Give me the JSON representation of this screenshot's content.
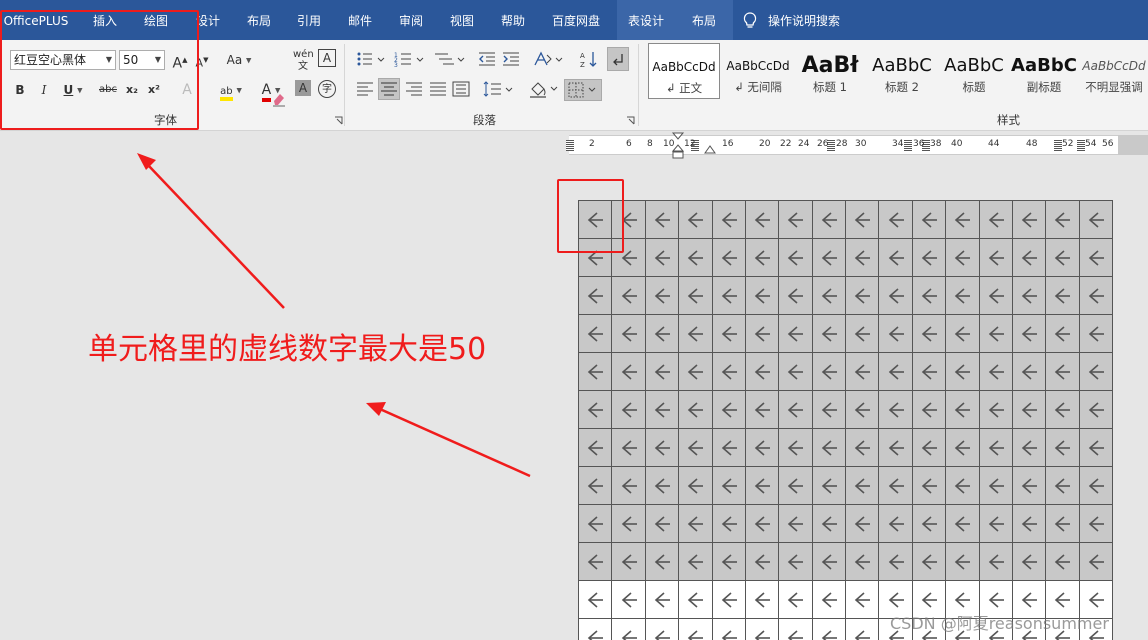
{
  "menu": {
    "items": [
      "OfficePLUS",
      "插入",
      "绘图",
      "设计",
      "布局",
      "引用",
      "邮件",
      "审阅",
      "视图",
      "帮助",
      "百度网盘"
    ],
    "context_tabs": [
      "表设计",
      "布局"
    ],
    "tell_me": "操作说明搜索"
  },
  "font_group": {
    "font_name": "红豆空心黑体",
    "font_size": "50",
    "grow_font": "A",
    "shrink_font": "A",
    "change_case": "Aa",
    "pinyin": "wén",
    "char_border": "A",
    "bold": "B",
    "italic": "I",
    "underline": "U",
    "strikethrough": "abc",
    "subscript": "x₂",
    "superscript": "x²",
    "text_effects": "A",
    "highlight": "ab",
    "font_color": "A",
    "char_shading": "A",
    "enclose_char": "字",
    "label": "字体"
  },
  "paragraph_group": {
    "label": "段落"
  },
  "styles_group": {
    "label": "样式",
    "styles": [
      {
        "sample": "AaBbCcDd",
        "name": "↲ 正文"
      },
      {
        "sample": "AaBbCcDd",
        "name": "↲ 无间隔"
      },
      {
        "sample": "AaBł",
        "name": "标题 1"
      },
      {
        "sample": "AaBbC",
        "name": "标题 2"
      },
      {
        "sample": "AaBbC",
        "name": "标题"
      },
      {
        "sample": "AaBbC",
        "name": "副标题"
      },
      {
        "sample": "AaBbCcDd",
        "name": "不明显强调"
      }
    ]
  },
  "ruler": {
    "numbers": [
      "2",
      "6",
      "8",
      "10",
      "12",
      "16",
      "20",
      "22",
      "24",
      "26",
      "28",
      "30",
      "34",
      "36",
      "38",
      "40",
      "44",
      "48",
      "52",
      "54",
      "56"
    ]
  },
  "table": {
    "columns": 16,
    "shaded_rows": 10,
    "white_rows": 2,
    "cell_glyph": "arrow-left"
  },
  "annotation": {
    "text": "单元格里的虚线数字最大是50"
  },
  "watermark": "CSDN @阿夏reasonsummer",
  "colors": {
    "menu_bg": "#2b579a",
    "annotation_red": "#f01c1c",
    "cell_shade": "#c8c8c8"
  }
}
